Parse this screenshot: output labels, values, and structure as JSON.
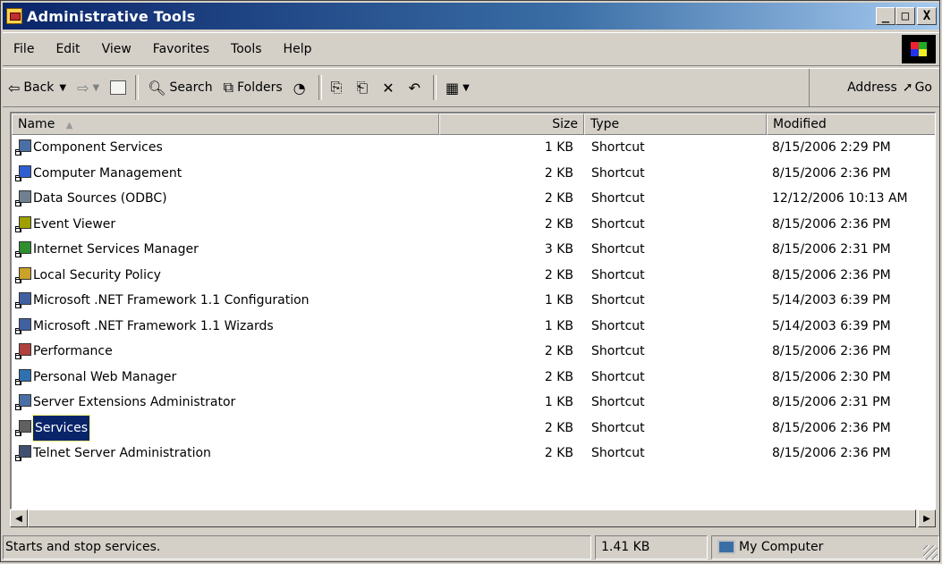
{
  "window": {
    "title": "Administrative Tools",
    "controls": {
      "minimize": "_",
      "maximize": "□",
      "close": "X"
    }
  },
  "menu": [
    "File",
    "Edit",
    "View",
    "Favorites",
    "Tools",
    "Help"
  ],
  "toolbar": {
    "back_label": "Back",
    "search_label": "Search",
    "folders_label": "Folders",
    "address_label": "Address",
    "go_label": "Go"
  },
  "columns": {
    "name": "Name",
    "size": "Size",
    "type": "Type",
    "modified": "Modified"
  },
  "files": [
    {
      "name": "Component Services",
      "size": "1 KB",
      "type": "Shortcut",
      "modified": "8/15/2006 2:29 PM",
      "icon": "component-services-icon"
    },
    {
      "name": "Computer Management",
      "size": "2 KB",
      "type": "Shortcut",
      "modified": "8/15/2006 2:36 PM",
      "icon": "computer-management-icon"
    },
    {
      "name": "Data Sources (ODBC)",
      "size": "2 KB",
      "type": "Shortcut",
      "modified": "12/12/2006 10:13 AM",
      "icon": "odbc-icon"
    },
    {
      "name": "Event Viewer",
      "size": "2 KB",
      "type": "Shortcut",
      "modified": "8/15/2006 2:36 PM",
      "icon": "event-viewer-icon"
    },
    {
      "name": "Internet Services Manager",
      "size": "3 KB",
      "type": "Shortcut",
      "modified": "8/15/2006 2:31 PM",
      "icon": "internet-services-icon"
    },
    {
      "name": "Local Security Policy",
      "size": "2 KB",
      "type": "Shortcut",
      "modified": "8/15/2006 2:36 PM",
      "icon": "security-policy-icon"
    },
    {
      "name": "Microsoft .NET Framework 1.1 Configuration",
      "size": "1 KB",
      "type": "Shortcut",
      "modified": "5/14/2003 6:39 PM",
      "icon": "dotnet-icon"
    },
    {
      "name": "Microsoft .NET Framework 1.1 Wizards",
      "size": "1 KB",
      "type": "Shortcut",
      "modified": "5/14/2003 6:39 PM",
      "icon": "dotnet-icon"
    },
    {
      "name": "Performance",
      "size": "2 KB",
      "type": "Shortcut",
      "modified": "8/15/2006 2:36 PM",
      "icon": "performance-icon"
    },
    {
      "name": "Personal Web Manager",
      "size": "2 KB",
      "type": "Shortcut",
      "modified": "8/15/2006 2:30 PM",
      "icon": "web-manager-icon"
    },
    {
      "name": "Server Extensions Administrator",
      "size": "1 KB",
      "type": "Shortcut",
      "modified": "8/15/2006 2:31 PM",
      "icon": "server-extensions-icon"
    },
    {
      "name": "Services",
      "size": "2 KB",
      "type": "Shortcut",
      "modified": "8/15/2006 2:36 PM",
      "icon": "services-icon",
      "selected": true
    },
    {
      "name": "Telnet Server Administration",
      "size": "2 KB",
      "type": "Shortcut",
      "modified": "8/15/2006 2:36 PM",
      "icon": "telnet-icon"
    }
  ],
  "status": {
    "description": "Starts and stop services.",
    "size": "1.41 KB",
    "zone": "My Computer"
  },
  "colors": {
    "title_start": "#0a246a",
    "title_end": "#a6caf0",
    "selection": "#0a246a",
    "chrome": "#d4d0c8"
  }
}
